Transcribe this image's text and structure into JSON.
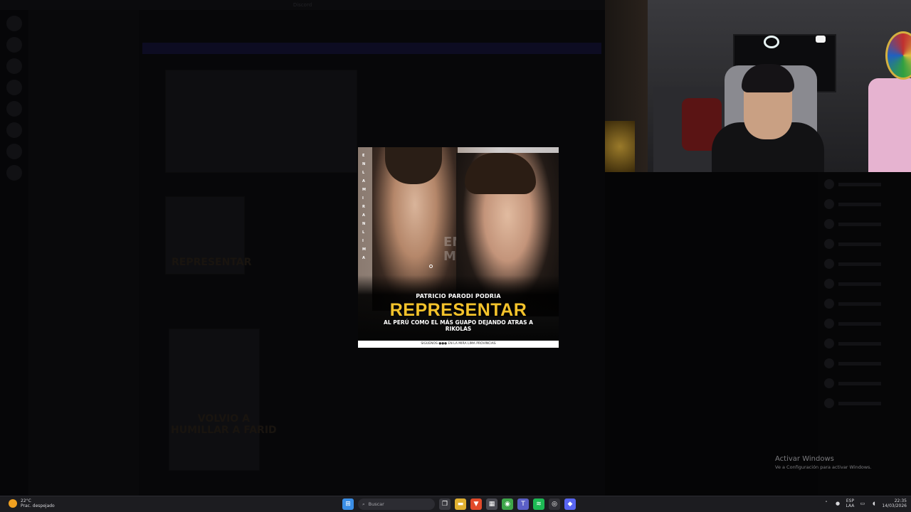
{
  "discord": {
    "title": "Discord",
    "channels": [
      "",
      "",
      "",
      "",
      "",
      "",
      "",
      "",
      "",
      "",
      "",
      "",
      "",
      "",
      "",
      "",
      "",
      "",
      "",
      "",
      "",
      "",
      "",
      "",
      "",
      "",
      "",
      ""
    ],
    "ghost_caption_1": "REPRESENTAR",
    "ghost_caption_2": "VOLVIO A\nHUMILLAR A FARID"
  },
  "viewer": {
    "side_letters": [
      "E",
      "N",
      "L",
      "A",
      "M",
      "I",
      "R",
      "A",
      "N",
      "L",
      "I",
      "M",
      "A"
    ],
    "bg_text": "ENLA\nMIRA",
    "headline_top": "PATRICIO PARODI PODRIA",
    "headline_main": "REPRESENTAR",
    "headline_sub": "AL PERÚ COMO EL MÁS GUAPO DEJANDO ATRAS A RIKOLAS",
    "footer": "SIGUENOS  ●●●  EN LA MIRA LIMA PROVINCIAS"
  },
  "watermark": {
    "title": "Activar Windows",
    "subtitle": "Ve a Configuración para activar Windows."
  },
  "taskbar": {
    "weather_temp": "22°C",
    "weather_desc": "Prac. despejado",
    "search_placeholder": "Buscar",
    "lang_top": "ESP",
    "lang_bottom": "LAA",
    "time": "22:35",
    "date": "14/03/2026",
    "apps": [
      {
        "name": "start-icon",
        "color": "#3a8ee6",
        "glyph": "⊞"
      },
      {
        "name": "task-view-icon",
        "color": "#3a3a40",
        "glyph": "❐"
      },
      {
        "name": "file-explorer-icon",
        "color": "#e0b030",
        "glyph": "▬"
      },
      {
        "name": "brave-icon",
        "color": "#e24a2a",
        "glyph": "▼"
      },
      {
        "name": "calculator-icon",
        "color": "#4a4a52",
        "glyph": "▦"
      },
      {
        "name": "chrome-icon",
        "color": "#3da64a",
        "glyph": "◉"
      },
      {
        "name": "teams-icon",
        "color": "#5b5fc7",
        "glyph": "T"
      },
      {
        "name": "spotify-icon",
        "color": "#1db954",
        "glyph": "≋"
      },
      {
        "name": "obs-icon",
        "color": "#303036",
        "glyph": "◎"
      },
      {
        "name": "discord-icon",
        "color": "#5865f2",
        "glyph": "◆"
      }
    ]
  }
}
